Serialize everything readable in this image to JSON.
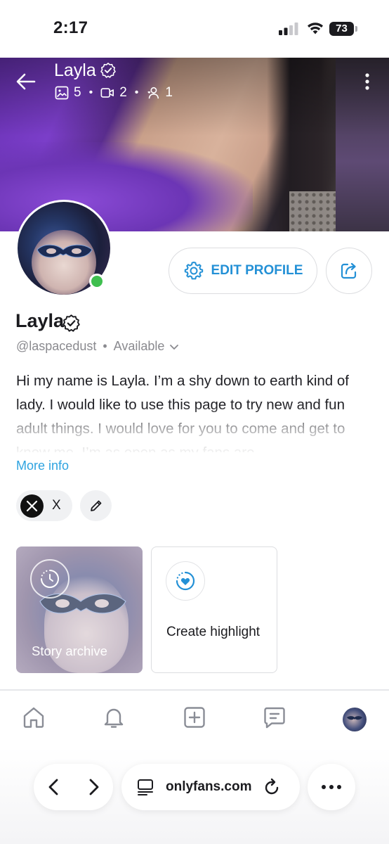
{
  "status_bar": {
    "time": "2:17",
    "battery": "73"
  },
  "cover": {
    "name": "Layla",
    "stats": {
      "photos": "5",
      "videos": "2",
      "fans": "1"
    }
  },
  "profile": {
    "name": "Layla",
    "handle": "@laspacedust",
    "separator": "•",
    "availability": "Available",
    "bio": "Hi my name is Layla. I’m a shy down to earth kind of lady. I would like to use this page to try new and fun adult things. I would love for you to come and get to know me. I’m as open as my fans are",
    "more_info": "More info",
    "edit_label": "EDIT PROFILE",
    "online": true
  },
  "social": {
    "label": "X"
  },
  "stories": {
    "archive_label": "Story archive",
    "create_label": "Create highlight"
  },
  "browser": {
    "url": "onlyfans.com"
  },
  "colors": {
    "accent": "#2390d6",
    "link": "#2ea3e0",
    "online": "#3fbf4f",
    "icon": "#8a8d96",
    "border": "#dcdde0"
  },
  "icons": {
    "back": "arrow-left-icon",
    "verified": "verified-badge-icon",
    "photos": "image-icon",
    "videos": "video-icon",
    "fans": "fans-icon",
    "more": "more-vertical-icon",
    "edit": "gear-icon",
    "share": "share-icon",
    "x": "x-logo-icon",
    "pencil": "pencil-icon",
    "archive": "clock-icon",
    "highlight": "heart-icon",
    "home": "home-icon",
    "bell": "bell-icon",
    "add": "plus-square-icon",
    "messages": "message-icon",
    "tabs": "tabs-icon",
    "reload": "reload-icon",
    "safari_more": "ellipsis-icon"
  }
}
